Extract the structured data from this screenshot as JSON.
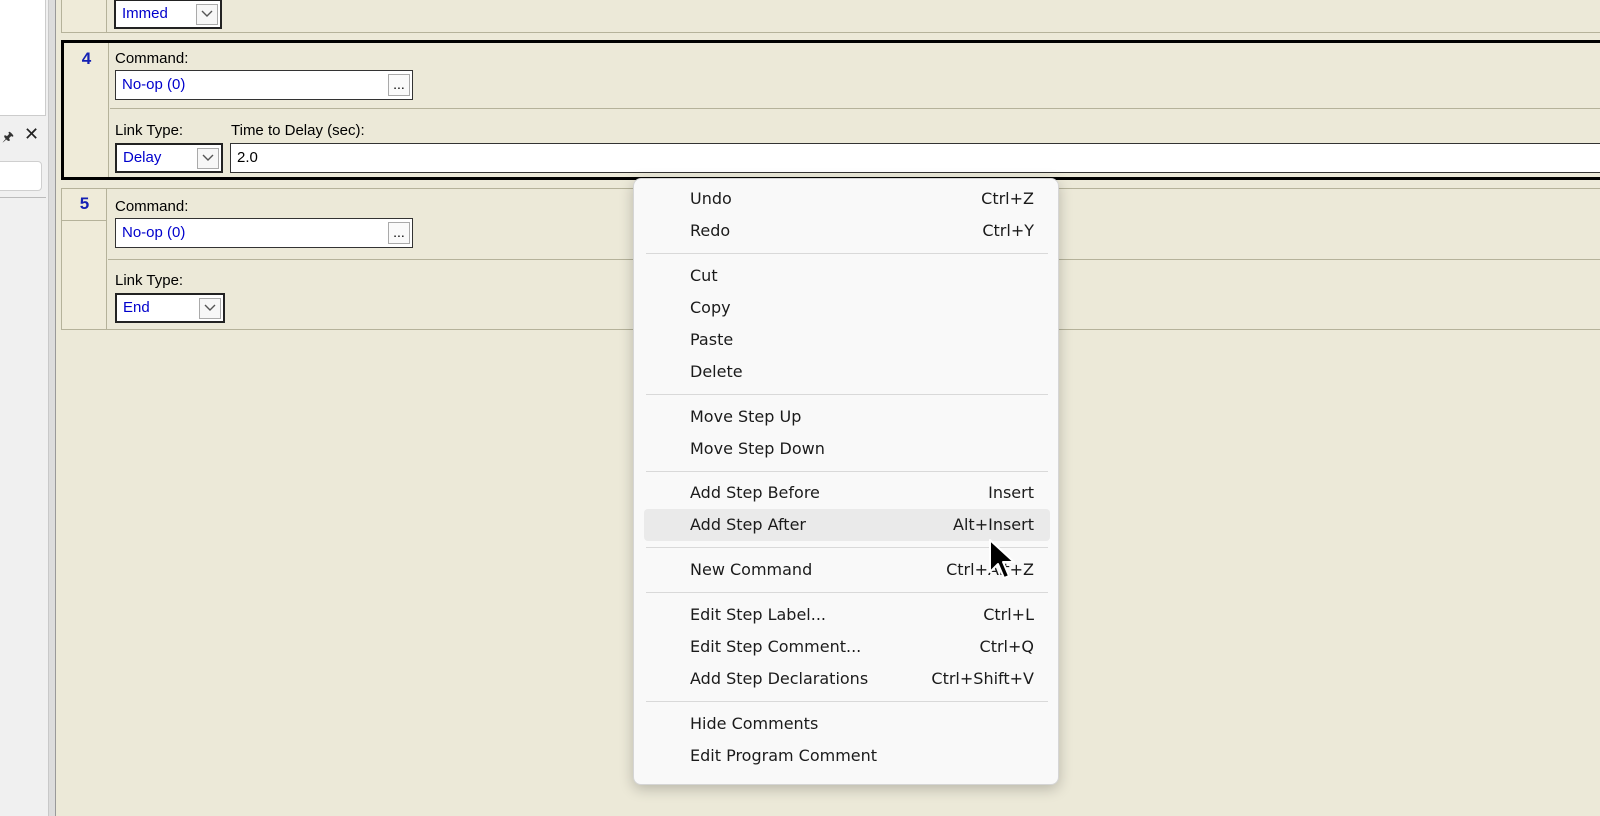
{
  "steps": {
    "step3": {
      "link_type_value": "Immed"
    },
    "step4": {
      "number": "4",
      "command_label": "Command:",
      "command_value": "No-op (0)",
      "ellipsis": "...",
      "link_type_label": "Link Type:",
      "link_type_value": "Delay",
      "delay_label": "Time to Delay (sec):",
      "delay_value": "2.0"
    },
    "step5": {
      "number": "5",
      "command_label": "Command:",
      "command_value": "No-op (0)",
      "ellipsis": "...",
      "link_type_label": "Link Type:",
      "link_type_value": "End"
    }
  },
  "left_panel": {
    "pin_icon": "pin-icon",
    "close_icon": "close-icon"
  },
  "context_menu": {
    "undo": {
      "label": "Undo",
      "shortcut": "Ctrl+Z"
    },
    "redo": {
      "label": "Redo",
      "shortcut": "Ctrl+Y"
    },
    "cut": {
      "label": "Cut"
    },
    "copy": {
      "label": "Copy"
    },
    "paste": {
      "label": "Paste"
    },
    "delete": {
      "label": "Delete"
    },
    "move_up": {
      "label": "Move Step Up"
    },
    "move_down": {
      "label": "Move Step Down"
    },
    "add_before": {
      "label": "Add Step Before",
      "shortcut": "Insert"
    },
    "add_after": {
      "label": "Add Step After",
      "shortcut": "Alt+Insert"
    },
    "new_command": {
      "label": "New Command",
      "shortcut": "Ctrl+Alt+Z"
    },
    "edit_label": {
      "label": "Edit Step Label...",
      "shortcut": "Ctrl+L"
    },
    "edit_comment": {
      "label": "Edit Step Comment...",
      "shortcut": "Ctrl+Q"
    },
    "add_declarations": {
      "label": "Add Step Declarations",
      "shortcut": "Ctrl+Shift+V"
    },
    "hide_comments": {
      "label": "Hide Comments"
    },
    "edit_program_comment": {
      "label": "Edit Program Comment"
    }
  },
  "colors": {
    "step_number": "#1420b4",
    "field_text": "#0000cc",
    "background": "#ece9d8"
  }
}
